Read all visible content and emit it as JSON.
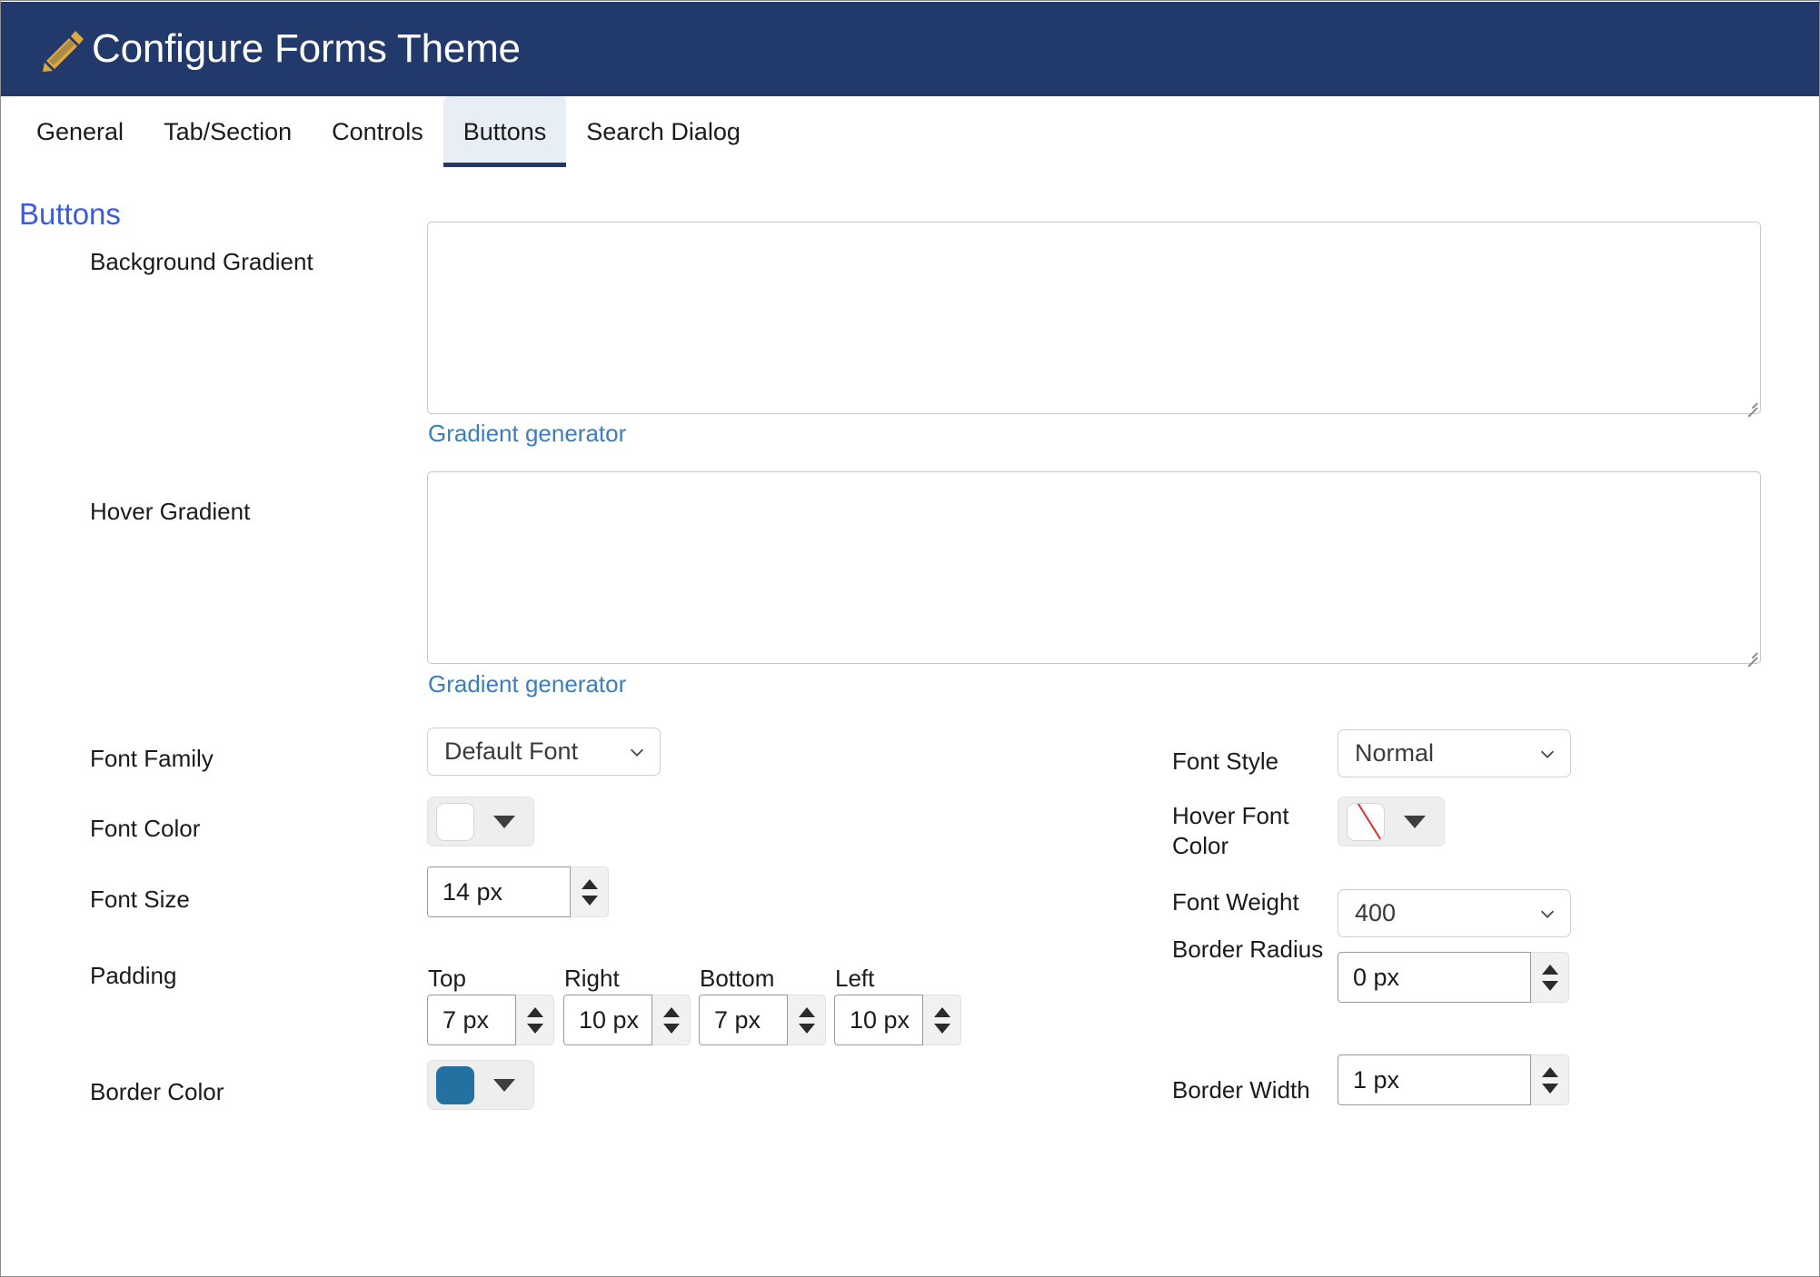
{
  "window": {
    "title": "Configure Forms Theme",
    "title_icon": "pencil-icon",
    "header_bg": "#223A6B",
    "icon_color": "#E0A93B"
  },
  "tabs": [
    {
      "label": "General",
      "active": false
    },
    {
      "label": "Tab/Section",
      "active": false
    },
    {
      "label": "Controls",
      "active": false
    },
    {
      "label": "Buttons",
      "active": true
    },
    {
      "label": "Search Dialog",
      "active": false
    }
  ],
  "section": {
    "title": "Buttons",
    "title_color": "#3b5bdb"
  },
  "fields": {
    "background_gradient": {
      "label": "Background Gradient",
      "value": "",
      "link_label": "Gradient generator"
    },
    "hover_gradient": {
      "label": "Hover Gradient",
      "value": "",
      "link_label": "Gradient generator"
    },
    "font_family": {
      "label": "Font Family",
      "value": "Default Font"
    },
    "font_style": {
      "label": "Font Style",
      "value": "Normal"
    },
    "font_color": {
      "label": "Font Color",
      "swatch_color": "#ffffff",
      "is_empty": false
    },
    "hover_font_color": {
      "label": "Hover Font Color",
      "swatch_color": "#ffffff",
      "is_empty": true,
      "empty_slash_color": "#e03131"
    },
    "font_size": {
      "label": "Font Size",
      "value": "14 px"
    },
    "font_weight": {
      "label": "Font Weight",
      "value": "400"
    },
    "padding": {
      "label": "Padding",
      "top": {
        "head": "Top",
        "value": "7 px"
      },
      "right": {
        "head": "Right",
        "value": "10 px"
      },
      "bottom": {
        "head": "Bottom",
        "value": "7 px"
      },
      "left": {
        "head": "Left",
        "value": "10 px"
      }
    },
    "border_radius": {
      "label": "Border Radius",
      "value": "0 px"
    },
    "border_color": {
      "label": "Border Color",
      "swatch_color": "#2371a0"
    },
    "border_width": {
      "label": "Border Width",
      "value": "1 px"
    }
  }
}
